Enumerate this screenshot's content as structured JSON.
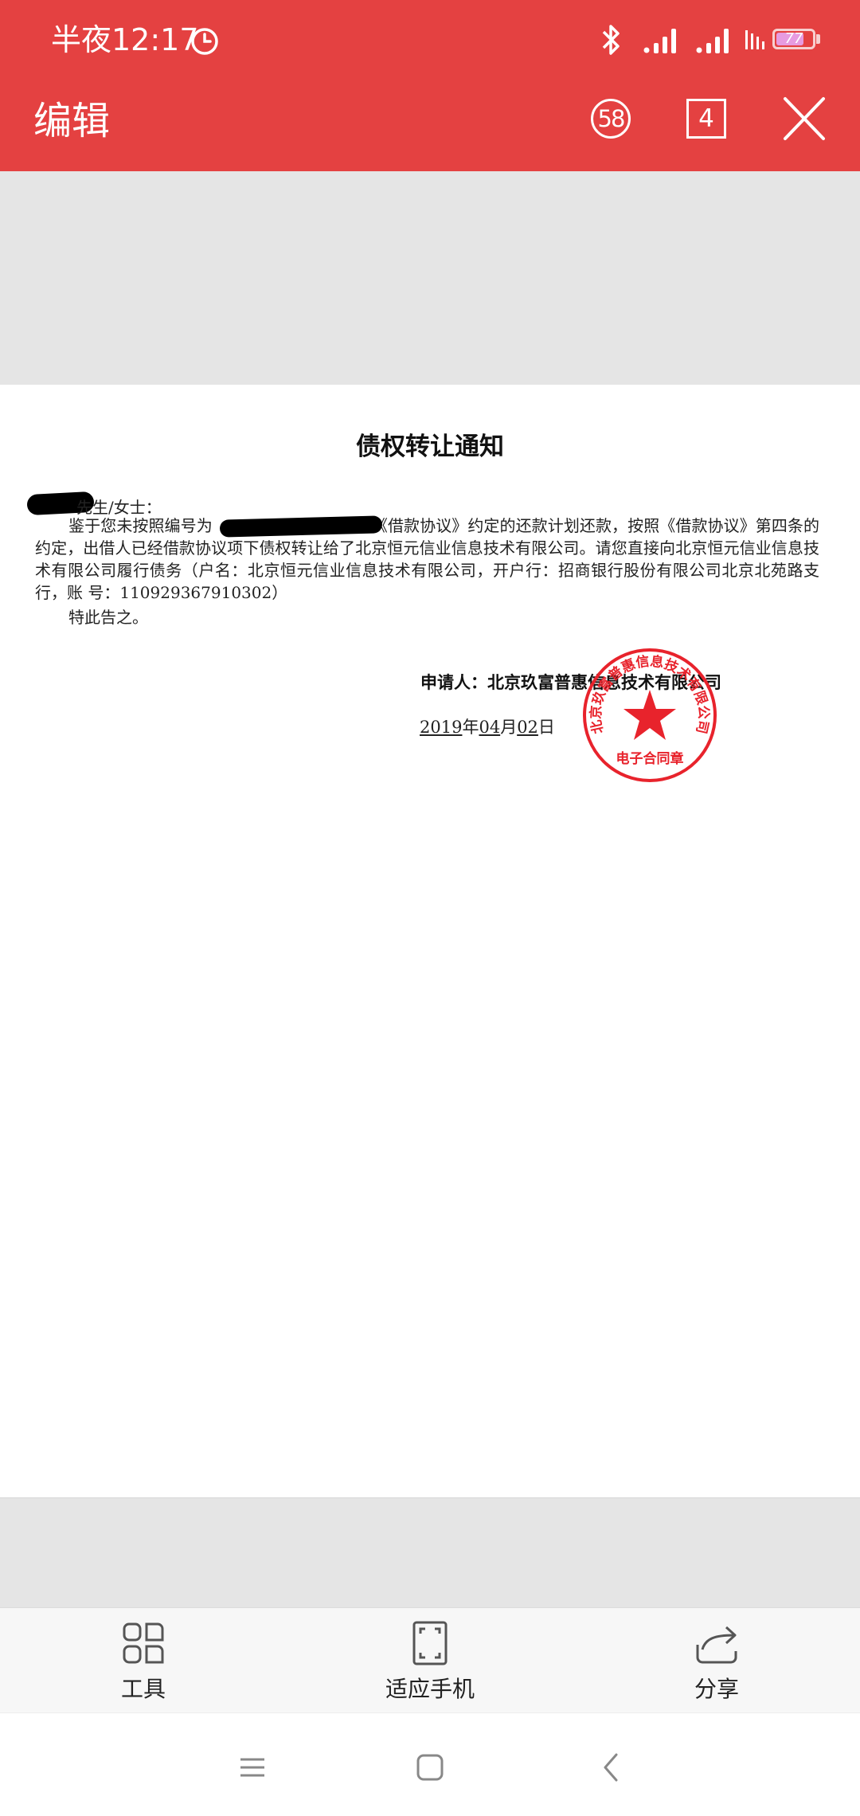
{
  "status_bar": {
    "time": "半夜12:17",
    "battery": "77",
    "battery_level": 0.77,
    "icons": [
      "alarm-icon",
      "bluetooth-icon",
      "signal-icon",
      "signal-icon",
      "wifi-icon",
      "battery-icon"
    ]
  },
  "toolbar": {
    "title": "编辑",
    "page_count": "58",
    "current_page": "4",
    "close_icon": "close-icon"
  },
  "document": {
    "title": "债权转让通知",
    "salutation": "先生/女士：",
    "paragraph_prefix": "鉴于您未按照编号为",
    "paragraph_body": "《借款协议》约定的还款计划还款，按照《借款协议》第四条的约定，出借人已经借款协议项下债权转让给了北京恒元信业信息技术有限公司。请您直接向北京恒元信业信息技术有限公司履行债务（户名：北京恒元信业信息技术有限公司，开户行：招商银行股份有限公司北京北苑路支行，账 号：110929367910302）",
    "closing": "特此告之。",
    "applicant": "申请人：北京玖富普惠信息技术有限公司",
    "date_year": "2019",
    "date_year_suffix": "年",
    "date_month": "04",
    "date_month_suffix": "月",
    "date_day": "02",
    "date_day_suffix": "日",
    "seal": {
      "ring_text": "北京玖富普惠信息技术有限公司",
      "bottom_text": "电子合同章",
      "color": "#e8232c"
    }
  },
  "bottom_bar": {
    "tools": "工具",
    "fit_phone": "适应手机",
    "share": "分享"
  },
  "nav_bar": {
    "icons": [
      "menu-icon",
      "home-icon",
      "back-icon"
    ]
  },
  "colors": {
    "header": "#e44141",
    "page_background": "#e5e5e5"
  }
}
